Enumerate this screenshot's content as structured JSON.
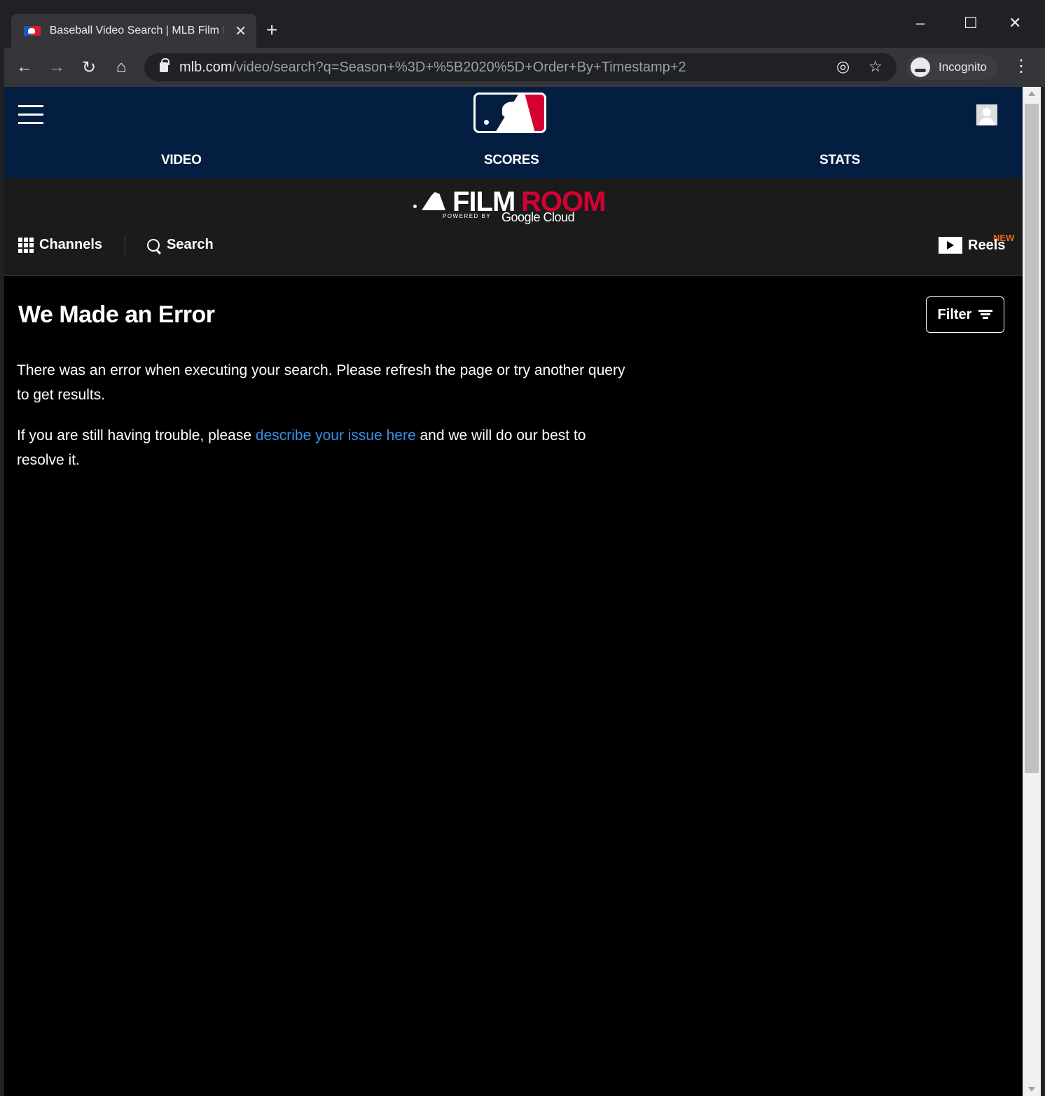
{
  "browser": {
    "tab_title": "Baseball Video Search | MLB Film Room",
    "tab_close": "✕",
    "new_tab": "+",
    "url_host": "mlb.com",
    "url_path": "/video/search?q=Season+%3D+%5B2020%5D+Order+By+Timestamp+2",
    "incognito_label": "Incognito",
    "window_controls": [
      "minimize-icon",
      "maximize-icon",
      "close-icon"
    ]
  },
  "header": {
    "nav": [
      "VIDEO",
      "SCORES",
      "STATS"
    ]
  },
  "film_room": {
    "logo_word_1": "FILM",
    "logo_word_2": "ROOM",
    "powered_by": "POWERED BY",
    "sponsor": "Google Cloud",
    "channels_label": "Channels",
    "search_label": "Search",
    "reels_label": "Reels",
    "reels_badge": "NEW"
  },
  "main": {
    "title": "We Made an Error",
    "filter_label": "Filter",
    "paragraph_1": "There was an error when executing your search. Please refresh the page or try another query to get results.",
    "paragraph_2_before": "If you are still having trouble, please ",
    "paragraph_2_link": "describe your issue here",
    "paragraph_2_after": " and we will do our best to resolve it."
  },
  "colors": {
    "header_navy": "#041e42",
    "accent_red": "#d50032",
    "link_blue": "#3a8ee6",
    "new_badge_orange": "#f26522"
  }
}
